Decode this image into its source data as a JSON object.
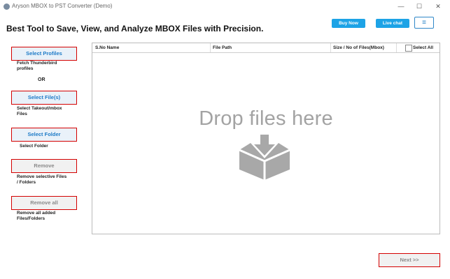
{
  "window": {
    "title": "Aryson MBOX to PST Converter (Demo)",
    "minimize_label": "—",
    "maximize_label": "☐",
    "close_label": "✕"
  },
  "header": {
    "heading": "Best Tool to Save, View, and Analyze MBOX Files with Precision.",
    "buy_now_label": "Buy Now",
    "live_chat_label": "Live chat",
    "menu_label": "≡"
  },
  "sidebar": {
    "select_profiles_label": "Select Profiles",
    "select_profiles_desc": [
      "Fetch Thunderbird",
      "profiles"
    ],
    "or_label": "OR",
    "select_files_label": "Select File(s)",
    "select_files_desc": [
      "Select Takeout/mbox",
      "Files"
    ],
    "select_folder_label": "Select Folder",
    "select_folder_desc": "Select Folder",
    "remove_label": "Remove",
    "remove_desc": [
      "Remove selective Files",
      "/ Folders"
    ],
    "remove_all_label": "Remove all",
    "remove_all_desc": [
      "Remove all added",
      "Files/Folders"
    ]
  },
  "table": {
    "columns": [
      "S.No Name",
      "File Path",
      "Size / No of Files(Mbox)"
    ],
    "select_all_label": "Select All",
    "select_all_checked": false,
    "drop_text": "Drop files here"
  },
  "footer": {
    "next_label": "Next >>"
  },
  "colors": {
    "accent_blue": "#1da3e6",
    "highlight_red": "#d40000",
    "drop_gray": "#a3a3a3"
  },
  "icons": {
    "app": "app-logo-icon",
    "drop": "download-tray-icon"
  }
}
